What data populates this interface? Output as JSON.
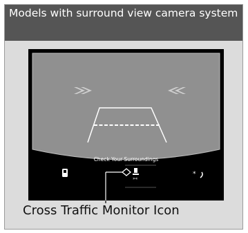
{
  "header": {
    "title": "Models with surround view camera system"
  },
  "screen": {
    "message": "Check Your Surroundings"
  },
  "icons": {
    "left": "car-door-icon",
    "center": "cross-traffic-monitor-icon",
    "right": "brightness-icon"
  },
  "callout": {
    "label": "Cross Traffic Monitor Icon"
  },
  "colors": {
    "header_bg": "#555555",
    "panel_bg": "#dcdcdc",
    "camera_view": "#909090",
    "screen_bg": "#000000"
  }
}
